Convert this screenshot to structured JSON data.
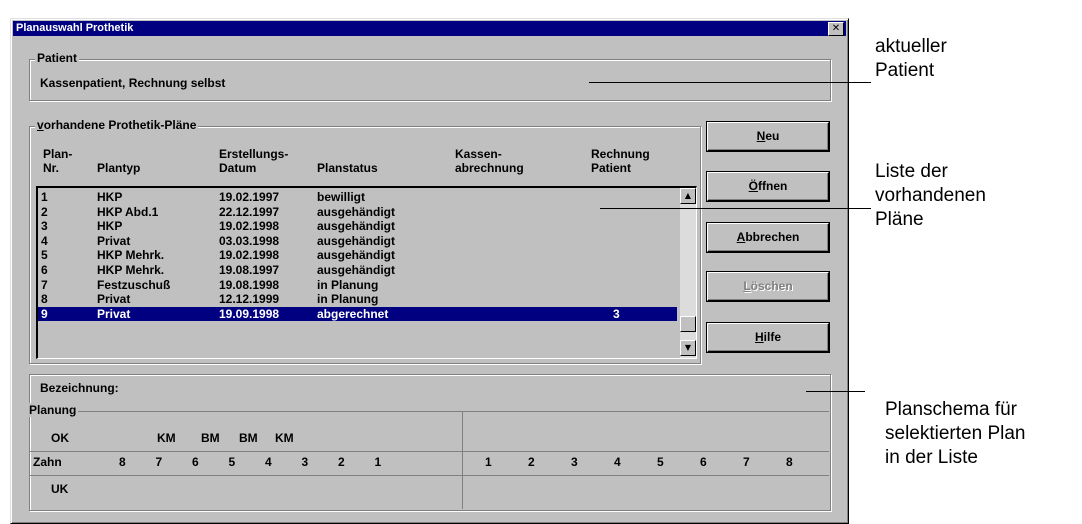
{
  "window": {
    "title": "Planauswahl Prothetik"
  },
  "patient": {
    "legend": "Patient",
    "text": "Kassenpatient, Rechnung selbst"
  },
  "plans": {
    "legend": "vorhandene Prothetik-Pläne",
    "columns": [
      [
        "Plan-",
        "Nr."
      ],
      [
        "",
        "Plantyp"
      ],
      [
        "Erstellungs-",
        "Datum"
      ],
      [
        "",
        "Planstatus"
      ],
      [
        "Kassen-",
        "abrechnung"
      ],
      [
        "Rechnung",
        "Patient"
      ]
    ],
    "rows": [
      [
        "1",
        "HKP",
        "19.02.1997",
        "bewilligt",
        "",
        ""
      ],
      [
        "2",
        "HKP Abd.1",
        "22.12.1997",
        "ausgehändigt",
        "",
        ""
      ],
      [
        "3",
        "HKP",
        "19.02.1998",
        "ausgehändigt",
        "",
        ""
      ],
      [
        "4",
        "Privat",
        "03.03.1998",
        "ausgehändigt",
        "",
        ""
      ],
      [
        "5",
        "HKP Mehrk.",
        "19.02.1998",
        "ausgehändigt",
        "",
        ""
      ],
      [
        "6",
        "HKP Mehrk.",
        "19.08.1997",
        "ausgehändigt",
        "",
        ""
      ],
      [
        "7",
        "Festzuschuß",
        "19.08.1998",
        "in Planung",
        "",
        ""
      ],
      [
        "8",
        "Privat",
        "12.12.1999",
        "in Planung",
        "",
        ""
      ],
      [
        "9",
        "Privat",
        "19.09.1998",
        "abgerechnet",
        "",
        "3"
      ]
    ],
    "selected_index": 8
  },
  "buttons": {
    "neu": {
      "mnemonic": "N",
      "rest": "eu"
    },
    "oeffnen": {
      "mnemonic": "Ö",
      "rest": "ffnen"
    },
    "abbrechen": {
      "mnemonic": "A",
      "rest": "bbrechen"
    },
    "loeschen": {
      "mnemonic": "L",
      "rest": "öschen",
      "disabled": true
    },
    "hilfe": {
      "mnemonic": "H",
      "rest": "ilfe"
    }
  },
  "schema": {
    "bezeichnung_label": "Bezeichnung:",
    "planung_legend": "Planung",
    "ok_label": "OK",
    "zahn_label": "Zahn",
    "uk_label": "UK",
    "ok_marks_left": [
      "KM",
      "BM",
      "BM",
      "KM"
    ],
    "teeth_left": [
      "8",
      "7",
      "6",
      "5",
      "4",
      "3",
      "2",
      "1"
    ],
    "teeth_right": [
      "1",
      "2",
      "3",
      "4",
      "5",
      "6",
      "7",
      "8"
    ]
  },
  "annotations": {
    "patient": [
      "aktueller",
      "Patient"
    ],
    "list": [
      "Liste der",
      "vorhandenen",
      "Pläne"
    ],
    "schema": [
      "Planschema für",
      "selektierten Plan",
      "in der Liste"
    ]
  }
}
